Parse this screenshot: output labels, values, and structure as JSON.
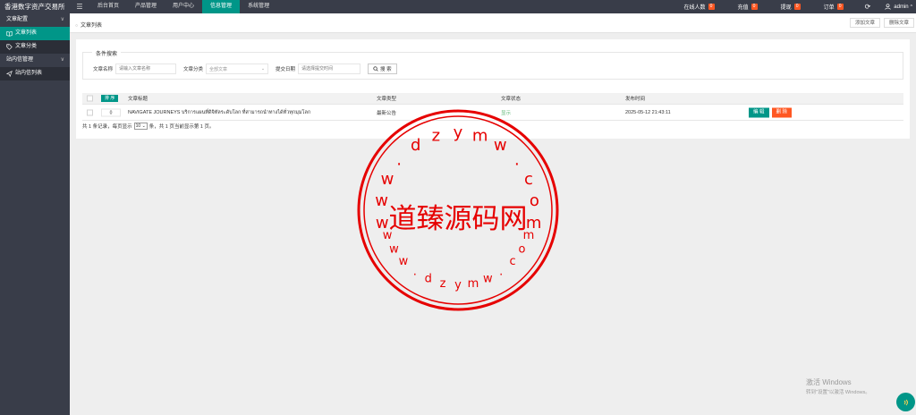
{
  "app": {
    "title": "香港数字资产交易所"
  },
  "topnav": {
    "items": [
      {
        "label": "后台首页",
        "active": false
      },
      {
        "label": "产品管理",
        "active": false
      },
      {
        "label": "用户中心",
        "active": false
      },
      {
        "label": "信息管理",
        "active": true
      },
      {
        "label": "系统管理",
        "active": false
      }
    ]
  },
  "topright": {
    "online": {
      "label": "在线人数",
      "count": "0"
    },
    "recharge": {
      "label": "充值",
      "count": "0"
    },
    "withdraw": {
      "label": "提现",
      "count": "0"
    },
    "orders": {
      "label": "订单",
      "count": "0"
    },
    "user": "admin"
  },
  "sidebar": {
    "groups": [
      {
        "label": "文章配置",
        "items": [
          {
            "label": "文章列表",
            "active": true,
            "icon": "book-icon"
          },
          {
            "label": "文章分类",
            "active": false,
            "icon": "tag-icon"
          }
        ]
      },
      {
        "label": "站内信管理",
        "items": [
          {
            "label": "站内信列表",
            "active": false,
            "icon": "send-icon"
          }
        ]
      }
    ]
  },
  "tabbar": {
    "title": "文章列表",
    "add_label": "添加文章",
    "delete_label": "删除文章"
  },
  "filter": {
    "legend": "条件搜索",
    "name_label": "文章名称",
    "name_placeholder": "请输入文章名称",
    "category_label": "文章分类",
    "category_value": "全部文章",
    "date_label": "提交日期",
    "date_placeholder": "请选择提交时间",
    "search_label": "搜 索"
  },
  "table": {
    "sort_label": "排 序",
    "headers": {
      "title": "文章标题",
      "type": "文章类型",
      "status": "文章状态",
      "time": "发布时间"
    },
    "rows": [
      {
        "sort": "0",
        "title": "NAVIGATE JOURNEYS บริการแผนที่ดิจิทัลระดับโลก ที่สามารถนำทางได้ทั่วทุกมุมโลก",
        "type": "最新公告",
        "status": "显示",
        "time": "2025-05-12 21:43:11",
        "edit_label": "编 辑",
        "delete_label": "删 除"
      }
    ]
  },
  "pager": {
    "prefix": "共 1 条记录，每页显示",
    "page_size": "10",
    "suffix": "条，共 1 页当前显示第 1 页。"
  },
  "watermark": {
    "text": "道臻源码网",
    "url_chars": [
      "w",
      "w",
      "w",
      ".",
      "d",
      "z",
      "y",
      "m",
      "w",
      ".",
      "c",
      "o",
      "m"
    ]
  },
  "windows_notice": {
    "title": "激活 Windows",
    "subtitle": "转到\"设置\"以激活 Windows。"
  },
  "colors": {
    "accent": "#009688",
    "danger": "#ff5722",
    "topbar": "#393d49",
    "stamp": "#e60000"
  }
}
